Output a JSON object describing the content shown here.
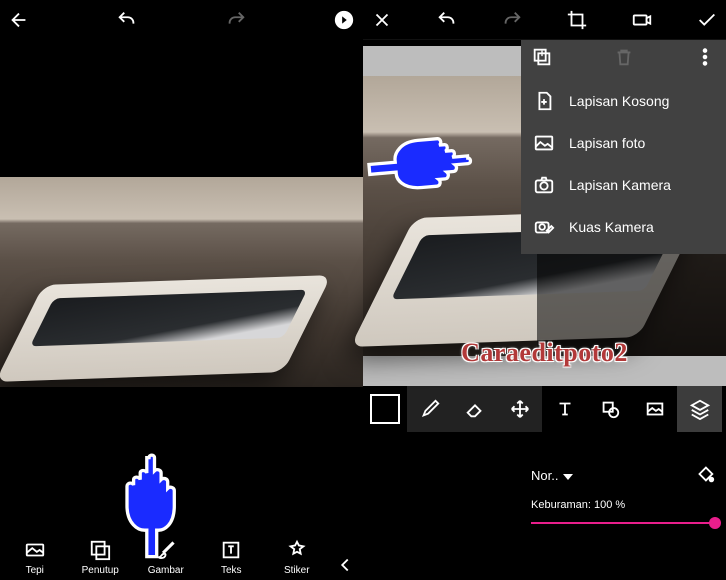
{
  "left": {
    "bbar": [
      {
        "id": "tepi",
        "label": "Tepi"
      },
      {
        "id": "penutup",
        "label": "Penutup"
      },
      {
        "id": "gambar",
        "label": "Gambar"
      },
      {
        "id": "teks",
        "label": "Teks"
      },
      {
        "id": "stiker",
        "label": "Stiker"
      }
    ]
  },
  "right": {
    "menu": [
      {
        "id": "empty",
        "label": "Lapisan Kosong"
      },
      {
        "id": "photo",
        "label": "Lapisan foto"
      },
      {
        "id": "camera",
        "label": "Lapisan Kamera"
      },
      {
        "id": "brushcam",
        "label": "Kuas Kamera"
      }
    ],
    "mode_label": "Nor..",
    "blur_label": "Keburaman:",
    "blur_value": "100 %"
  },
  "watermark": "Caraeditpoto2"
}
